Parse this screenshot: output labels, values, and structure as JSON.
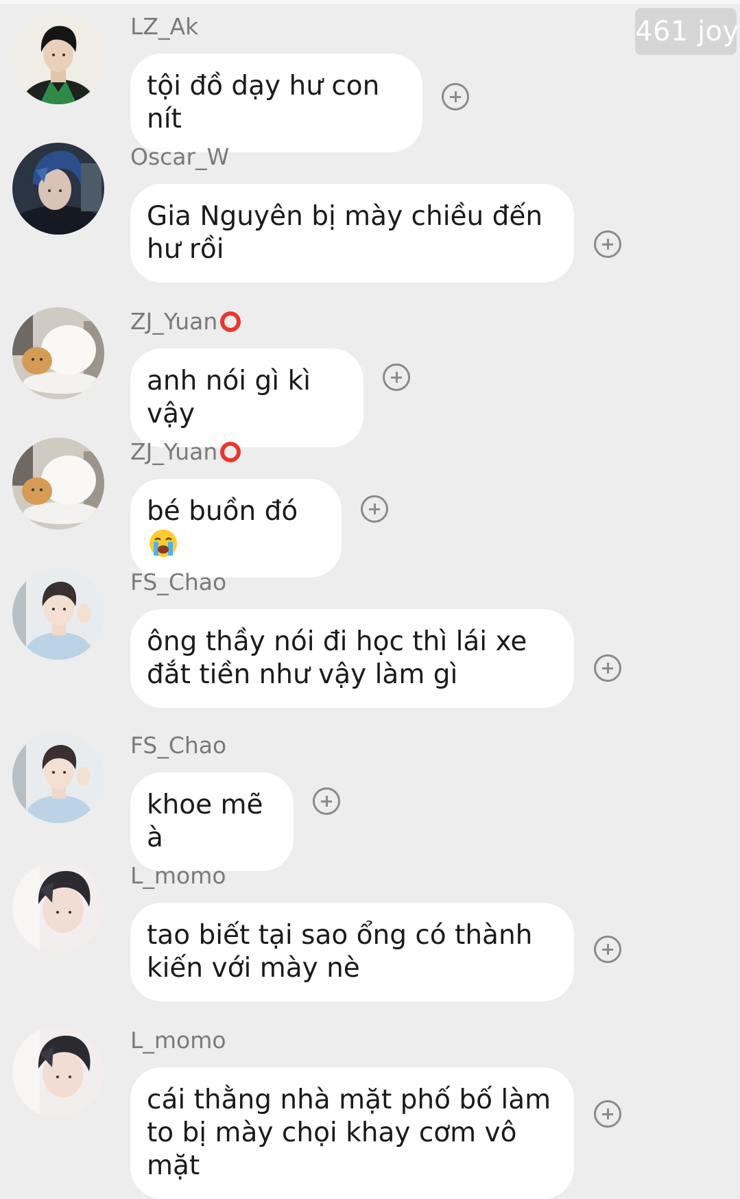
{
  "watermark": "461 joy",
  "messages": [
    {
      "user": "LZ_Ak",
      "text": "tội đồ dạy hư con nít",
      "badge": false,
      "avatar": "avatar-lz-ak"
    },
    {
      "user": "Oscar_W",
      "text": "Gia Nguyên bị mày chiều đến hư rồi",
      "badge": false,
      "avatar": "avatar-oscar-w"
    },
    {
      "user": "ZJ_Yuan",
      "text": "anh nói gì kì vậy",
      "badge": true,
      "avatar": "avatar-zj-yuan"
    },
    {
      "user": "ZJ_Yuan",
      "text": "bé buồn đó",
      "emoji": "loudly-crying-face",
      "badge": true,
      "avatar": "avatar-zj-yuan"
    },
    {
      "user": "FS_Chao",
      "text": "ông thầy nói đi học thì lái xe đắt tiền như vậy làm gì",
      "badge": false,
      "avatar": "avatar-fs-chao"
    },
    {
      "user": "FS_Chao",
      "text": "khoe mẽ à",
      "badge": false,
      "avatar": "avatar-fs-chao"
    },
    {
      "user": "L_momo",
      "text": "tao biết tại sao ổng có thành kiến với mày nè",
      "badge": false,
      "avatar": "avatar-l-momo"
    },
    {
      "user": "L_momo",
      "text": "cái thằng nhà mặt phố bố làm to bị mày chọi khay cơm vô mặt",
      "badge": false,
      "avatar": "avatar-l-momo"
    }
  ],
  "icons": {
    "react": "plus-circle-icon",
    "badge": "red-ring-badge-icon"
  },
  "colors": {
    "background": "#ededed",
    "bubble": "#ffffff",
    "username": "#7a7a7a",
    "badge": "#e8382f"
  }
}
